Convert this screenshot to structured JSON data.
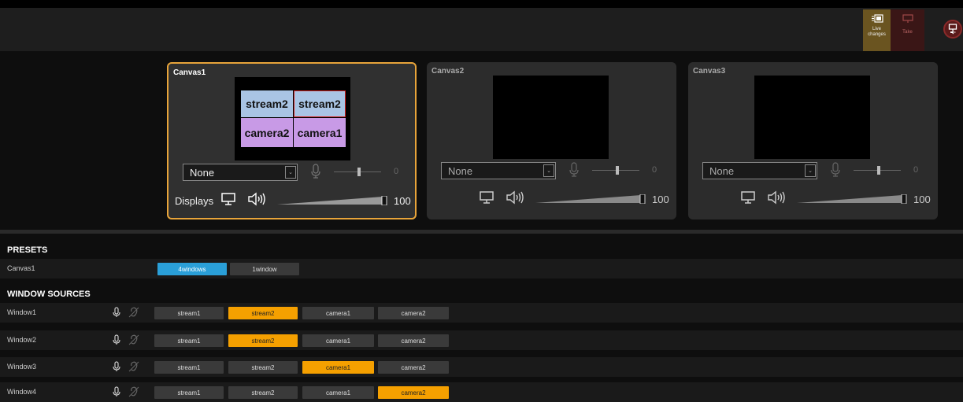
{
  "toolbar": {
    "live_label_1": "Live",
    "live_label_2": "changes",
    "take_label": "Take"
  },
  "canvases": [
    {
      "title": "Canvas1",
      "tiles": [
        "stream2",
        "stream2",
        "camera2",
        "camera1"
      ],
      "audio_select": "None",
      "audio_volume": "0",
      "displays_label": "Displays",
      "display_volume": "100"
    },
    {
      "title": "Canvas2",
      "audio_select": "None",
      "audio_volume": "0",
      "display_volume": "100"
    },
    {
      "title": "Canvas3",
      "audio_select": "None",
      "audio_volume": "0",
      "display_volume": "100"
    }
  ],
  "presets": {
    "heading": "PRESETS",
    "row_label": "Canvas1",
    "items": [
      "4windows",
      "1window"
    ],
    "selected": "4windows"
  },
  "window_sources": {
    "heading": "WINDOW SOURCES",
    "source_options": [
      "stream1",
      "stream2",
      "camera1",
      "camera2"
    ],
    "rows": [
      {
        "name": "Window1",
        "selected": "stream2"
      },
      {
        "name": "Window2",
        "selected": "stream2"
      },
      {
        "name": "Window3",
        "selected": "camera1"
      },
      {
        "name": "Window4",
        "selected": "camera2"
      }
    ]
  },
  "colors": {
    "accent_orange": "#f5a000",
    "accent_blue": "#2a9fd8",
    "active_canvas_border": "#e8a43a",
    "tile_blue": "#a9c4e4",
    "tile_purple": "#c89ae6"
  }
}
